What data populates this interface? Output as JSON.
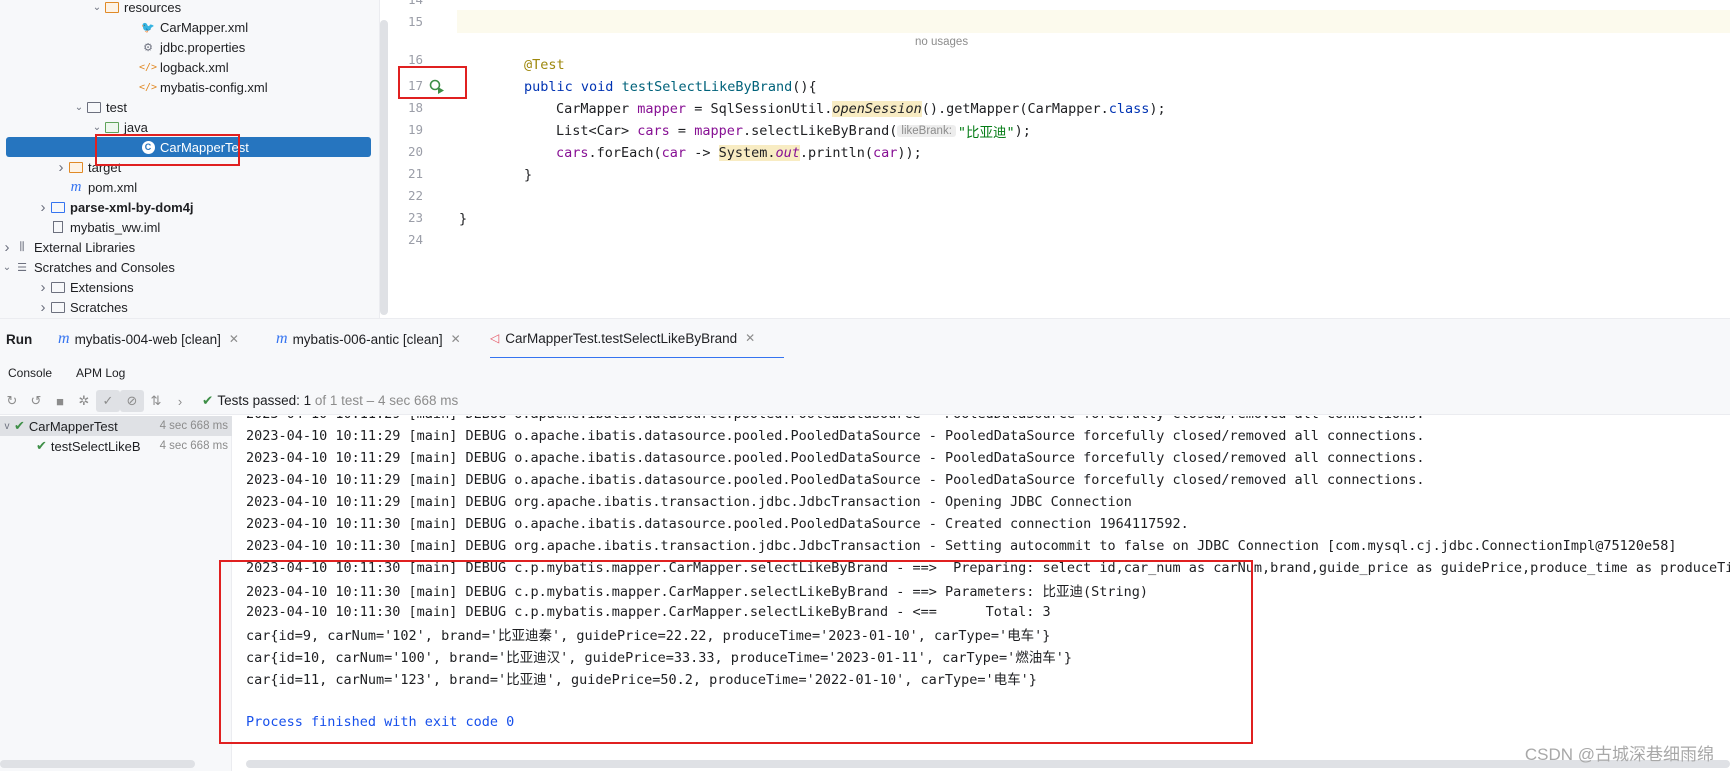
{
  "tree": {
    "items": [
      {
        "label": "resources",
        "type": "folder-orange",
        "indent": 5,
        "chev": "v"
      },
      {
        "label": "CarMapper.xml",
        "type": "mybatis",
        "indent": 7
      },
      {
        "label": "jdbc.properties",
        "type": "gear",
        "indent": 7
      },
      {
        "label": "logback.xml",
        "type": "xml",
        "indent": 7
      },
      {
        "label": "mybatis-config.xml",
        "type": "xml",
        "indent": 7
      },
      {
        "label": "test",
        "type": "folder",
        "indent": 4,
        "chev": "v"
      },
      {
        "label": "java",
        "type": "folder-green",
        "indent": 5,
        "chev": "v"
      },
      {
        "label": "CarMapperTest",
        "type": "class",
        "indent": 7,
        "selected": true
      },
      {
        "label": "target",
        "type": "folder-orange",
        "indent": 3,
        "chev": ">"
      },
      {
        "label": "pom.xml",
        "type": "maven",
        "indent": 3
      },
      {
        "label": "parse-xml-by-dom4j",
        "type": "module",
        "indent": 2,
        "chev": ">",
        "bold": true
      },
      {
        "label": "mybatis_ww.iml",
        "type": "file",
        "indent": 2
      },
      {
        "label": "External Libraries",
        "type": "libs",
        "indent": 0,
        "chev": ">"
      },
      {
        "label": "Scratches and Consoles",
        "type": "scratch",
        "indent": 0,
        "chev": "v"
      },
      {
        "label": "Extensions",
        "type": "folder",
        "indent": 2,
        "chev": ">"
      },
      {
        "label": "Scratches",
        "type": "folder",
        "indent": 2,
        "chev": ">"
      }
    ]
  },
  "editor": {
    "line_numbers": [
      "14",
      "15",
      "16",
      "17",
      "18",
      "19",
      "20",
      "21",
      "22",
      "23",
      "24"
    ],
    "no_usages": "no usages",
    "lines": {
      "l16_ann": "@Test",
      "l17_kw1": "public",
      "l17_kw2": "void",
      "l17_fn": "testSelectLikeByBrand",
      "l17_rest": "(){",
      "l18_a": "CarMapper ",
      "l18_var": "mapper",
      "l18_b": " = SqlSessionUtil.",
      "l18_m": "openSession",
      "l18_c": "().getMapper(CarMapper.",
      "l18_kw": "class",
      "l18_d": ");",
      "l19_a": "List<Car> ",
      "l19_var": "cars",
      "l19_b": " = ",
      "l19_var2": "mapper",
      "l19_c": ".selectLikeByBrand(",
      "l19_hint": "likeBrank:",
      "l19_str": "\"比亚迪\"",
      "l19_d": ");",
      "l20_var": "cars",
      "l20_a": ".forEach(",
      "l20_var2": "car",
      "l20_b": " -> ",
      "l20_sys": "System.",
      "l20_out": "out",
      "l20_c": ".println(",
      "l20_var3": "car",
      "l20_d": "));",
      "l21": "}",
      "l23": "}"
    }
  },
  "run": {
    "label": "Run",
    "tabs": [
      {
        "label": "mybatis-004-web [clean]",
        "icon": "m"
      },
      {
        "label": "mybatis-006-antic [clean]",
        "icon": "m"
      },
      {
        "label": "CarMapperTest.testSelectLikeByBrand",
        "icon": "test"
      }
    ],
    "subtabs": [
      "Console",
      "APM Log"
    ],
    "status_prefix": "Tests passed:",
    "status_count": "1",
    "status_rest": "of 1 test – 4 sec 668 ms"
  },
  "tests": [
    {
      "name": "CarMapperTest",
      "time": "4 sec 668 ms"
    },
    {
      "name": "testSelectLikeB",
      "time": "4 sec 668 ms"
    }
  ],
  "console": {
    "lines": [
      "2023-04-10 10:11:29 [main] DEBUG o.apache.ibatis.datasource.pooled.PooledDataSource - PooledDataSource forcefully closed/removed all connections.",
      "2023-04-10 10:11:29 [main] DEBUG o.apache.ibatis.datasource.pooled.PooledDataSource - PooledDataSource forcefully closed/removed all connections.",
      "2023-04-10 10:11:29 [main] DEBUG o.apache.ibatis.datasource.pooled.PooledDataSource - PooledDataSource forcefully closed/removed all connections.",
      "2023-04-10 10:11:29 [main] DEBUG org.apache.ibatis.transaction.jdbc.JdbcTransaction - Opening JDBC Connection",
      "2023-04-10 10:11:30 [main] DEBUG o.apache.ibatis.datasource.pooled.PooledDataSource - Created connection 1964117592.",
      "2023-04-10 10:11:30 [main] DEBUG org.apache.ibatis.transaction.jdbc.JdbcTransaction - Setting autocommit to false on JDBC Connection [com.mysql.cj.jdbc.ConnectionImpl@75120e58]",
      "2023-04-10 10:11:30 [main] DEBUG c.p.mybatis.mapper.CarMapper.selectLikeByBrand - ==>  Preparing: select id,car_num as carNum,brand,guide_price as guidePrice,produce_time as produceTime,",
      "2023-04-10 10:11:30 [main] DEBUG c.p.mybatis.mapper.CarMapper.selectLikeByBrand - ==> Parameters: 比亚迪(String)",
      "2023-04-10 10:11:30 [main] DEBUG c.p.mybatis.mapper.CarMapper.selectLikeByBrand - <==      Total: 3",
      "car{id=9, carNum='102', brand='比亚迪秦', guidePrice=22.22, produceTime='2023-01-10', carType='电车'}",
      "car{id=10, carNum='100', brand='比亚迪汉', guidePrice=33.33, produceTime='2023-01-11', carType='燃油车'}",
      "car{id=11, carNum='123', brand='比亚迪', guidePrice=50.2, produceTime='2022-01-10', carType='电车'}",
      "",
      "Process finished with exit code 0"
    ]
  },
  "watermark": "CSDN @古城深巷细雨绵",
  "colors": {
    "accent": "#3574f0",
    "selected": "#2675bf",
    "annotation_red": "#e02020",
    "pass_green": "#3e8f47"
  }
}
